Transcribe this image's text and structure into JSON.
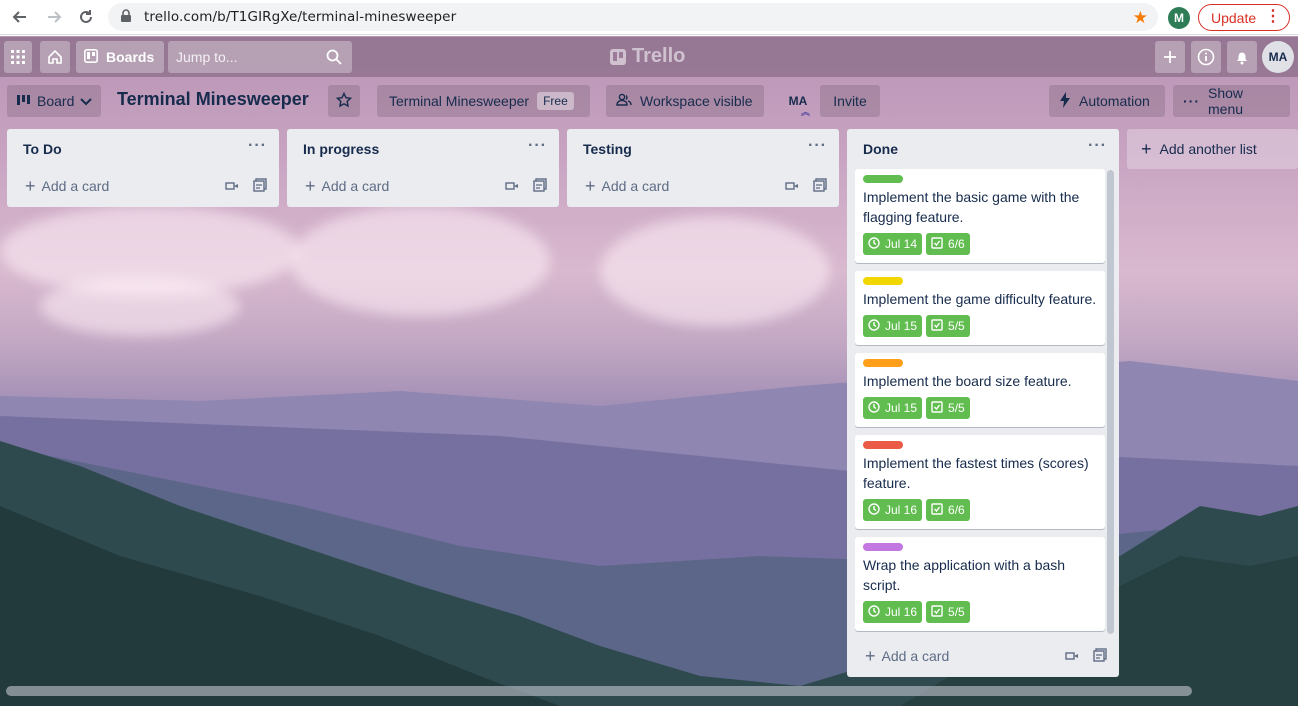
{
  "browser": {
    "url": "trello.com/b/T1GIRgXe/terminal-minesweeper",
    "profile_initial": "M",
    "update_label": "Update"
  },
  "header": {
    "boards_label": "Boards",
    "search_placeholder": "Jump to...",
    "logo_text": "Trello",
    "avatar": "MA"
  },
  "board": {
    "view_label": "Board",
    "title": "Terminal Minesweeper",
    "workspace_name": "Terminal Minesweeper",
    "plan_badge": "Free",
    "visibility_label": "Workspace visible",
    "member_avatar": "MA",
    "invite_label": "Invite",
    "automation_label": "Automation",
    "menu_label": "Show menu"
  },
  "lists": [
    {
      "name": "To Do",
      "add_card": "Add a card"
    },
    {
      "name": "In progress",
      "add_card": "Add a card"
    },
    {
      "name": "Testing",
      "add_card": "Add a card"
    },
    {
      "name": "Done",
      "add_card": "Add a card",
      "cards": [
        {
          "title": "Implement the basic game with the flagging feature.",
          "label_color": "#61bd4f",
          "due": "Jul 14",
          "checklist": "6/6"
        },
        {
          "title": "Implement the game difficulty feature.",
          "label_color": "#f2d600",
          "due": "Jul 15",
          "checklist": "5/5"
        },
        {
          "title": "Implement the board size feature.",
          "label_color": "#ff9f1a",
          "due": "Jul 15",
          "checklist": "5/5"
        },
        {
          "title": "Implement the fastest times (scores) feature.",
          "label_color": "#eb5a46",
          "due": "Jul 16",
          "checklist": "6/6"
        },
        {
          "title": "Wrap the application with a bash script.",
          "label_color": "#c377e0",
          "due": "Jul 16",
          "checklist": "5/5"
        }
      ]
    }
  ],
  "add_list_label": "Add another list"
}
